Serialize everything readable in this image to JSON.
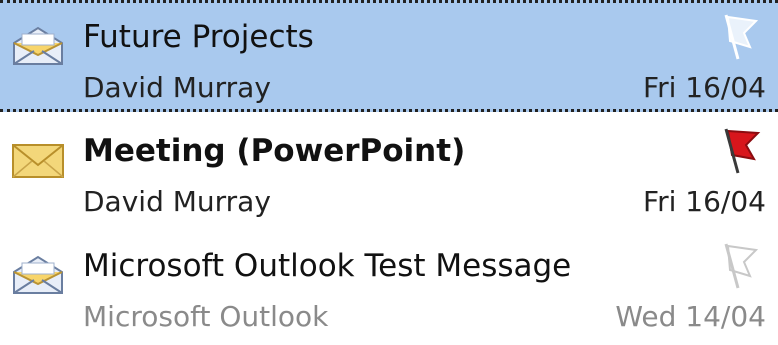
{
  "messages": [
    {
      "subject": "Future Projects",
      "sender": "David Murray",
      "date": "Fri 16/04",
      "icon": "envelope-open-icon",
      "flag": "flag-outline-icon",
      "selected": true,
      "unread": false
    },
    {
      "subject": "Meeting (PowerPoint)",
      "sender": "David Murray",
      "date": "Fri 16/04",
      "icon": "envelope-closed-icon",
      "flag": "flag-red-icon",
      "selected": false,
      "unread": true
    },
    {
      "subject": "Microsoft Outlook Test Message",
      "sender": "Microsoft Outlook",
      "date": "Wed 14/04",
      "icon": "envelope-open-icon",
      "flag": "flag-outline-icon",
      "selected": false,
      "unread": false
    }
  ],
  "colors": {
    "selection": "#a9c9ee",
    "flag_red": "#d8161c",
    "envelope": "#f3d77a"
  }
}
